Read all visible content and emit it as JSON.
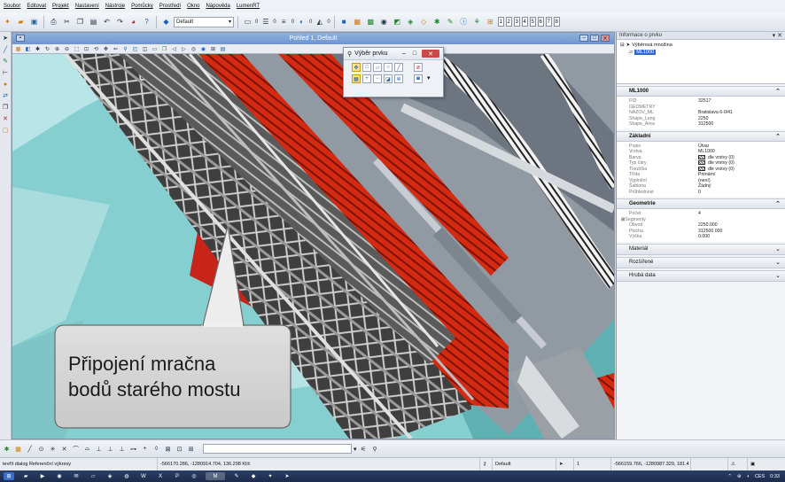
{
  "menu": [
    "Soubor",
    "Editovat",
    "Projekt",
    "Nastavení",
    "Nástroje",
    "Pomůcky",
    "Prostředí",
    "Okno",
    "Nápověda",
    "LumenRT"
  ],
  "toolbar": {
    "level_combo": "Default",
    "counters": [
      "0",
      "0",
      "0",
      "0",
      "0"
    ],
    "view_buttons": [
      "1",
      "2",
      "3",
      "4",
      "5",
      "6",
      "7",
      "8"
    ]
  },
  "view": {
    "title": "Pohled 1, Default"
  },
  "popup": {
    "title": "Výběr prvku"
  },
  "callout": {
    "line1": "Připojení mračna",
    "line2": "bodů starého mostu"
  },
  "panel": {
    "title": "Informace o prvku",
    "tree_root": "Výběrová množina",
    "tree_child": "ML1000",
    "sections": {
      "ml": {
        "head": "ML1000",
        "rows": [
          {
            "k": "FID",
            "v": "32517"
          },
          {
            "k": "GEOMETRY",
            "v": ""
          },
          {
            "k": "NAZOV_ML",
            "v": "Bratislava 6-0/41"
          },
          {
            "k": "Shape_Leng",
            "v": "2250"
          },
          {
            "k": "Shape_Area",
            "v": "312500"
          }
        ]
      },
      "basic": {
        "head": "Základní",
        "rows": [
          {
            "k": "Popis",
            "v": "Útvar"
          },
          {
            "k": "Vrstva",
            "v": "ML1000"
          },
          {
            "k": "Barva",
            "v": "dle vrstvy (0)",
            "swatch": true
          },
          {
            "k": "Typ čáry",
            "v": "dle vrstvy (0)",
            "swatch": true
          },
          {
            "k": "Tloušťka",
            "v": "dle vrstvy (0)",
            "swatch": true
          },
          {
            "k": "Třída",
            "v": "Primární"
          },
          {
            "k": "Vyplnění",
            "v": "(není)"
          },
          {
            "k": "Šablona",
            "v": "Žádný"
          },
          {
            "k": "Průhlednost",
            "v": "0"
          }
        ]
      },
      "geometry": {
        "head": "Geometrie",
        "rows": [
          {
            "k": "Počet",
            "v": "4"
          },
          {
            "k": "Segmenty",
            "v": "",
            "tree": true
          },
          {
            "k": "Obvod",
            "v": "2250.000"
          },
          {
            "k": "Plocha",
            "v": "312500.000"
          },
          {
            "k": "Výška",
            "v": "0.000"
          }
        ]
      }
    },
    "collapsed": [
      "Materiál",
      "Rozšířené",
      "Hrubá data"
    ]
  },
  "status": {
    "prompt": "tevřít dialog Referenční výkresy",
    "coords1": "-566170.286, -1280914.704, 136.298 Klíč",
    "level": "Default",
    "count": "1",
    "coords2": "-566159.766, -1280987.329, 181.4"
  },
  "taskbar": {
    "lang": "CES",
    "time": "0:33"
  }
}
